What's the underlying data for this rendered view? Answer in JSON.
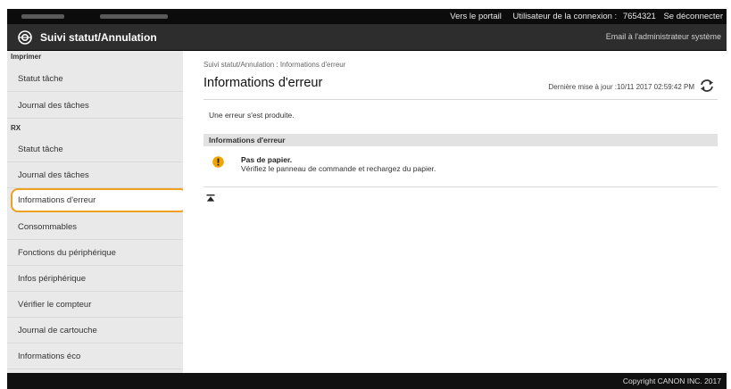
{
  "topbar": {
    "portal_link": "Vers le portail",
    "user_label": "Utilisateur de la connexion :",
    "user_id": "7654321",
    "logout_link": "Se déconnecter"
  },
  "header": {
    "title": "Suivi statut/Annulation",
    "mail_admin": "Email à l'administrateur système"
  },
  "sidebar": {
    "sections": [
      {
        "title": "Imprimer"
      },
      {
        "title": "RX"
      }
    ],
    "items": [
      {
        "label": "Statut tâche"
      },
      {
        "label": "Journal des tâches"
      },
      {
        "label": "Statut tâche"
      },
      {
        "label": "Journal des tâches"
      },
      {
        "label": "Informations d'erreur"
      },
      {
        "label": "Consommables"
      },
      {
        "label": "Fonctions du périphérique"
      },
      {
        "label": "Infos périphérique"
      },
      {
        "label": "Vérifier le compteur"
      },
      {
        "label": "Journal de cartouche"
      },
      {
        "label": "Informations éco"
      }
    ]
  },
  "main": {
    "breadcrumb": "Suivi statut/Annulation : Informations d'erreur",
    "title": "Informations d'erreur",
    "last_updated": "Dernière mise à jour :10/11 2017 02:59:42 PM",
    "message": "Une erreur s'est produite.",
    "section_title": "Informations d'erreur",
    "error_title": "Pas de papier.",
    "error_detail": "Vérifiez le panneau de commande et rechargez du papier."
  },
  "footer": {
    "copyright": "Copyright CANON INC. 2017"
  },
  "colors": {
    "header_bg": "#2d2d2d",
    "topbar_bg": "#0c0c0c",
    "highlight_border": "#f0a020",
    "warning_icon": "#f0a500"
  },
  "icons": {
    "logo": "canon-logo-icon",
    "refresh": "refresh-icon",
    "error": "warning-icon",
    "to_top": "go-to-top-icon"
  }
}
